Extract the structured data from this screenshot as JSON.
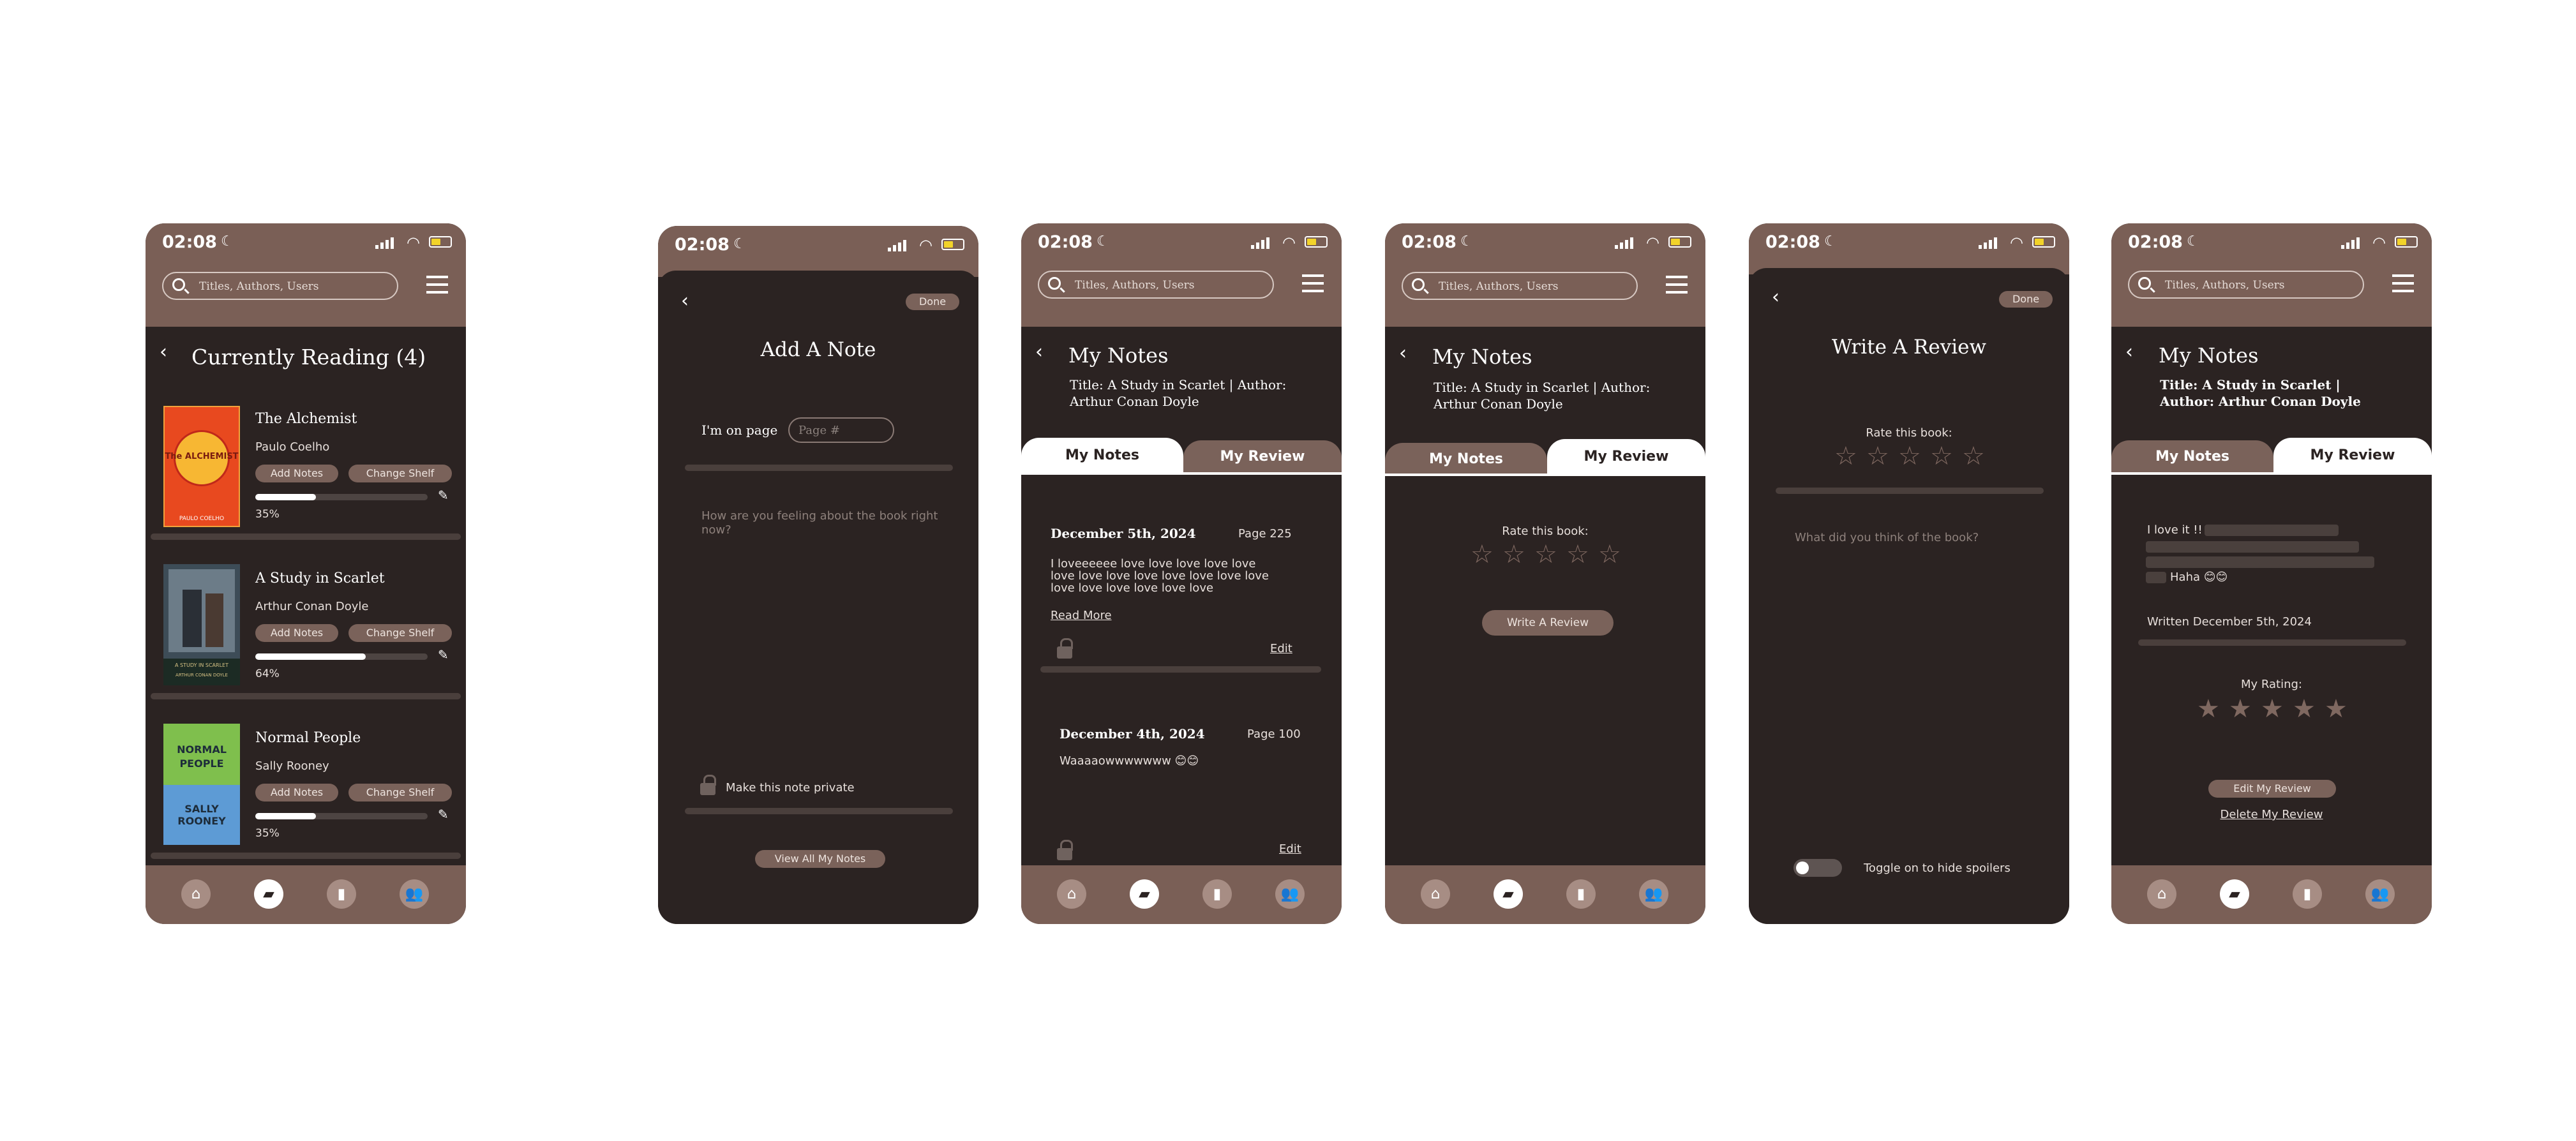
{
  "status": {
    "time": "02:08",
    "moon": "☾"
  },
  "search": {
    "placeholder": "Titles, Authors, Users"
  },
  "nav": {
    "home": "⌂",
    "bookmark": "▰",
    "stats": "▮",
    "friends": "👥"
  },
  "screen1": {
    "title": "Currently Reading (4)",
    "books": [
      {
        "title": "The Alchemist",
        "author": "Paulo Coelho",
        "add": "Add Notes",
        "change": "Change Shelf",
        "progress": 35,
        "progress_label": "35%",
        "cover_label": "The ALCHEMIST",
        "cover_author": "PAULO COELHO"
      },
      {
        "title": "A Study in Scarlet",
        "author": "Arthur Conan Doyle",
        "add": "Add Notes",
        "change": "Change Shelf",
        "progress": 64,
        "progress_label": "64%",
        "cover_label": "A STUDY IN SCARLET",
        "cover_author": "ARTHUR CONAN DOYLE"
      },
      {
        "title": "Normal People",
        "author": "Sally Rooney",
        "add": "Add Notes",
        "change": "Change Shelf",
        "progress": 35,
        "progress_label": "35%",
        "cover_label": "NORMAL PEOPLE",
        "cover_author": "SALLY ROONEY"
      }
    ]
  },
  "screen2": {
    "done": "Done",
    "title": "Add A Note",
    "page_label": "I'm on page",
    "page_placeholder": "Page #",
    "body_placeholder": "How are you feeling about the book right now?",
    "private": "Make this note private",
    "view_all": "View All My Notes"
  },
  "screen3": {
    "title": "My Notes",
    "meta": "Title: A Study in Scarlet  |  Author: Arthur Conan Doyle",
    "tab_notes": "My Notes",
    "tab_review": "My Review",
    "notes": [
      {
        "date": "December 5th, 2024",
        "page": "Page 225",
        "text": "I loveeeeee love love love love love love love love love love love love love love love love love love love",
        "read_more": "Read More",
        "edit": "Edit"
      },
      {
        "date": "December 4th, 2024",
        "page": "Page 100",
        "text": "Waaaaowwwwwww 😊😊",
        "edit": "Edit"
      }
    ]
  },
  "screen4": {
    "title": "My Notes",
    "meta": "Title: A Study in Scarlet  |  Author: Arthur Conan Doyle",
    "tab_notes": "My Notes",
    "tab_review": "My Review",
    "rate": "Rate this book:",
    "write": "Write A Review",
    "rating": 0
  },
  "screen5": {
    "done": "Done",
    "title": "Write A Review",
    "rate": "Rate this book:",
    "placeholder": "What did you think of the book?",
    "spoiler": "Toggle on to hide spoilers"
  },
  "screen6": {
    "title": "My Notes",
    "meta": "Title: A Study in Scarlet  |  Author: Arthur Conan Doyle",
    "tab_notes": "My Notes",
    "tab_review": "My Review",
    "review_start": "I love it !!",
    "review_end": "Haha 😊😊",
    "written": "Written December 5th, 2024",
    "rating_label": "My Rating:",
    "rating": 5,
    "edit": "Edit My Review",
    "delete": "Delete My Review"
  }
}
